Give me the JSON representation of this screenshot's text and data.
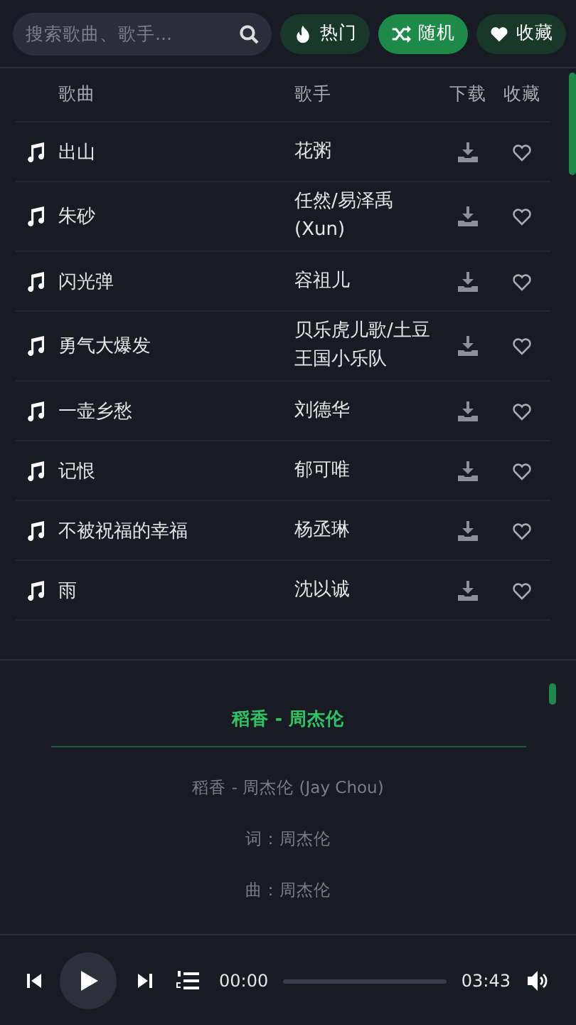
{
  "search": {
    "placeholder": "搜索歌曲、歌手..."
  },
  "tabs": [
    {
      "label": "热门",
      "kind": "hot",
      "selected": false
    },
    {
      "label": "随机",
      "kind": "shuffle",
      "selected": true
    },
    {
      "label": "收藏",
      "kind": "favorite",
      "selected": false
    }
  ],
  "table": {
    "columns": [
      "歌曲",
      "歌手",
      "下载",
      "收藏"
    ],
    "rows": [
      {
        "song": "出山",
        "artist": "花粥"
      },
      {
        "song": "朱砂",
        "artist": "任然/易泽禹(Xun)"
      },
      {
        "song": "闪光弹",
        "artist": "容祖儿"
      },
      {
        "song": "勇气大爆发",
        "artist": "贝乐虎儿歌/土豆王国小乐队"
      },
      {
        "song": "一壶乡愁",
        "artist": "刘德华"
      },
      {
        "song": "记恨",
        "artist": "郁可唯"
      },
      {
        "song": "不被祝福的幸福",
        "artist": "杨丞琳"
      },
      {
        "song": "雨",
        "artist": "沈以诚"
      }
    ]
  },
  "lyrics": {
    "title": "稻香 - 周杰伦",
    "lines": [
      "稻香 - 周杰伦 (Jay Chou)",
      "词：周杰伦",
      "曲：周杰伦"
    ]
  },
  "player": {
    "current_time": "00:00",
    "total_time": "03:43",
    "progress": {
      "level": 0
    }
  }
}
